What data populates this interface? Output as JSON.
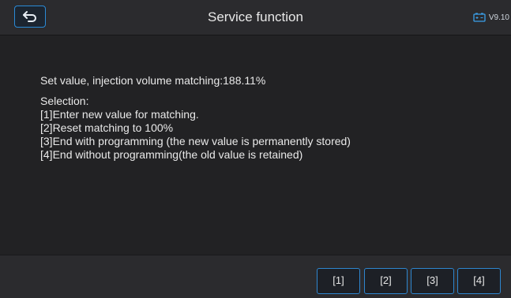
{
  "header": {
    "title": "Service function",
    "version": "V9.10",
    "back_icon": "back-arrow-icon",
    "battery_icon": "battery-icon",
    "accent_color": "#2a8ad6"
  },
  "main": {
    "status_line": "Set value, injection volume matching:188.11%",
    "selection_heading": "Selection:",
    "options": [
      "[1]Enter new value for matching.",
      "[2]Reset matching to 100%",
      "[3]End with programming (the new value is permanently stored)",
      "[4]End without programming(the old value is retained)"
    ]
  },
  "footer": {
    "buttons": [
      "[1]",
      "[2]",
      "[3]",
      "[4]"
    ]
  }
}
